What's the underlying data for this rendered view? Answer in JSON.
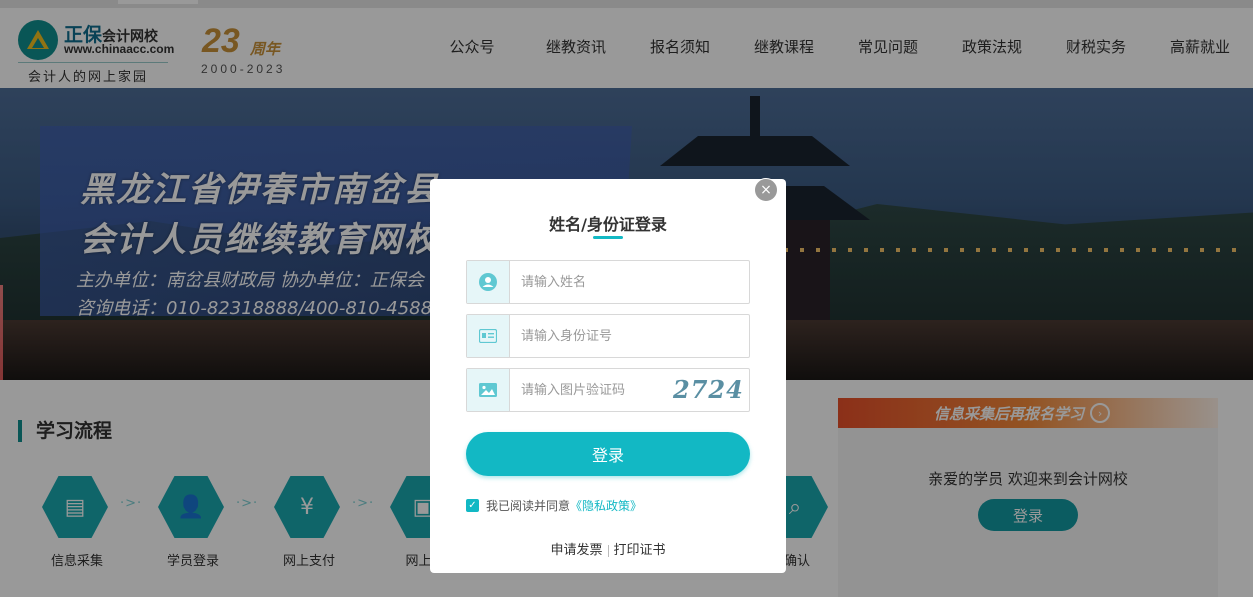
{
  "header": {
    "brand": "正保",
    "brand_sub": "会计网校",
    "url": "www.chinaacc.com",
    "slogan": "会计人的网上家园",
    "anniversary_number": "23",
    "anniversary_label": "周年",
    "anniversary_years": "2000-2023",
    "nav": [
      "公众号",
      "继教资讯",
      "报名须知",
      "继教课程",
      "常见问题",
      "政策法规",
      "财税实务",
      "高薪就业"
    ]
  },
  "banner": {
    "title_line1": "黑龙江省伊春市南岔县",
    "title_line2": "会计人员继续教育网校",
    "host_line": "主办单位：南岔县财政局    协办单位：正保会",
    "phone_line": "咨询电话：010-82318888/400-810-4588"
  },
  "study": {
    "title": "学习流程",
    "steps": [
      {
        "label": "信息采集",
        "icon": "clipboard-icon"
      },
      {
        "label": "学员登录",
        "icon": "user-check-icon"
      },
      {
        "label": "网上支付",
        "icon": "money-bag-icon"
      },
      {
        "label": "网上学",
        "icon": "id-card-icon"
      },
      {
        "label": "确认",
        "icon": "search-icon"
      }
    ],
    "arrow": "·>·"
  },
  "right_panel": {
    "banner_text": "信息采集后再报名学习",
    "banner_go": "›",
    "welcome": "亲爱的学员 欢迎来到会计网校",
    "login_label": "登录"
  },
  "modal": {
    "close": "×",
    "title": "姓名/身份证登录",
    "name_placeholder": "请输入姓名",
    "id_placeholder": "请输入身份证号",
    "captcha_placeholder": "请输入图片验证码",
    "captcha_value": "2724",
    "login_label": "登录",
    "agree_prefix": "我已阅读并同意",
    "agree_link": "《隐私政策》",
    "checked": "✓",
    "invoice_link": "申请发票",
    "print_link": "打印证书"
  },
  "colors": {
    "accent": "#12b8c4",
    "teal_dark": "#0f8f8f",
    "banner_orange": "#e8502a"
  }
}
